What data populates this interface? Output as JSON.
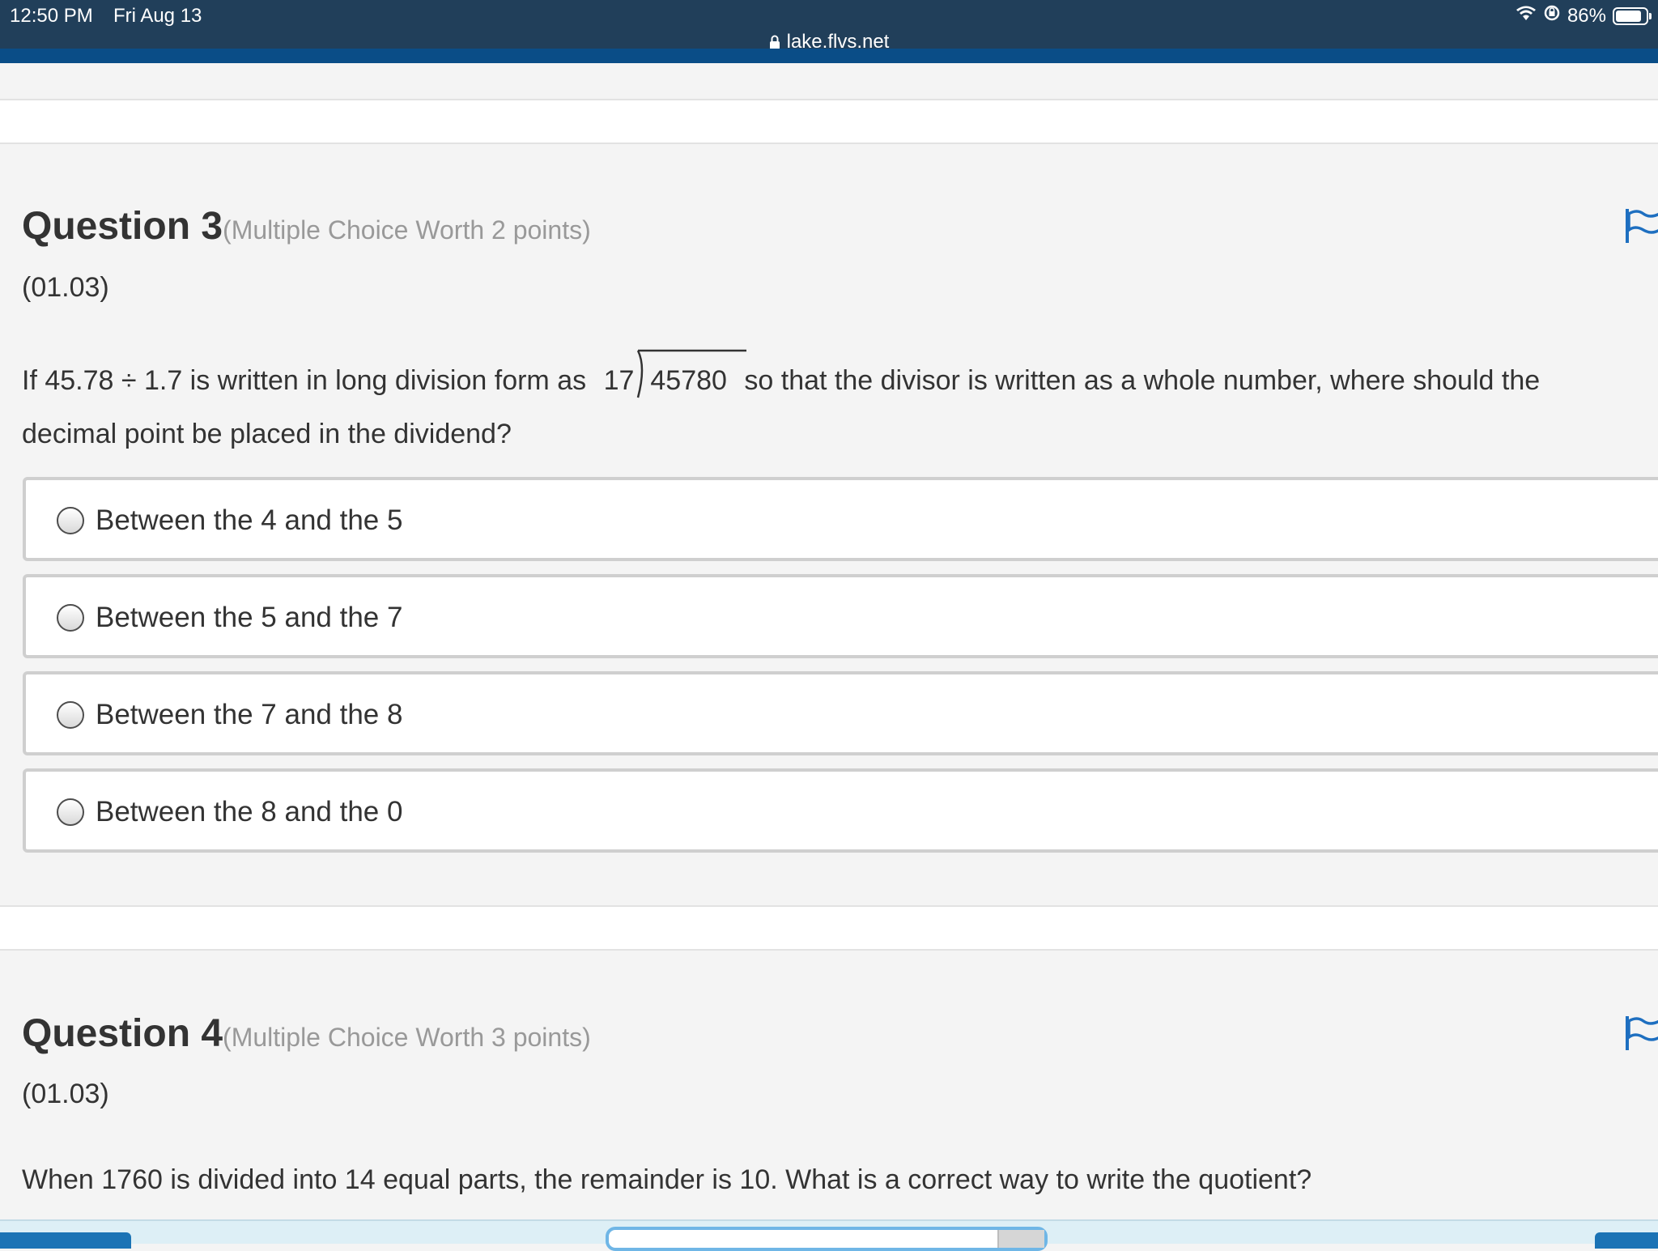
{
  "status_bar": {
    "time": "12:50 PM",
    "date": "Fri Aug 13",
    "battery": "86%",
    "battery_level": 0.86
  },
  "address_bar": {
    "url": "lake.flvs.net"
  },
  "questions": [
    {
      "title": "Question 3",
      "meta": "(Multiple Choice Worth 2 points)",
      "code": "(01.03)",
      "prompt_before": "If 45.78 ÷ 1.7 is written in long division form as",
      "long_division": {
        "divisor": "17",
        "dividend": "45780"
      },
      "prompt_after": "so that the divisor is written as a whole number, where should the",
      "prompt_line2": "decimal point be placed in the dividend?",
      "options": [
        "Between the 4 and the 5",
        "Between the 5 and the 7",
        "Between the 7 and the 8",
        "Between the 8 and the 0"
      ]
    },
    {
      "title": "Question 4",
      "meta": "(Multiple Choice Worth 3 points)",
      "code": "(01.03)",
      "prompt": "When 1760 is divided into 14 equal parts, the remainder is 10. What is a correct way to write the quotient?"
    }
  ],
  "colors": {
    "header_bg": "#213f5a",
    "header_accent": "#0a4d87",
    "page_bg": "#f4f4f4",
    "flag": "#1e6fc0",
    "muted_text": "#999999"
  },
  "icons": {
    "lock": "lock-icon",
    "wifi": "wifi-icon",
    "rotation_lock": "rotation-lock-icon",
    "battery": "battery-icon",
    "flag": "flag-icon"
  }
}
